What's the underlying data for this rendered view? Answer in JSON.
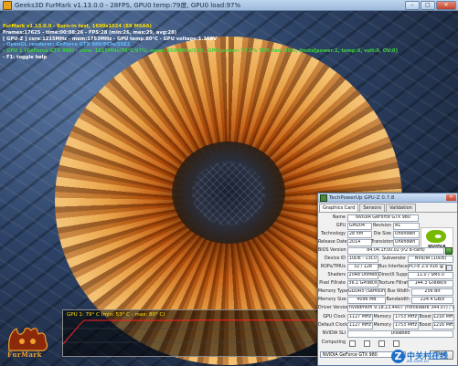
{
  "furmark": {
    "title": "Geeks3D FurMark v1.13.0.0 - 28FPS, GPU0 temp:79度, GPU0 load:97%",
    "controls": {
      "minimize": "–",
      "maximize": "□",
      "close": "✕"
    },
    "osd": [
      {
        "text": "FurMark v1.13.0.0 - Burn-in test, 1600x1024 (8X MSAA)",
        "color": "#ffe000"
      },
      {
        "text": "Frames:17625 - time:00:08:26 - FPS:28 (min:26, max:29, avg:28)",
        "color": "#ffffff"
      },
      {
        "text": "[ GPU-Z ] core:1215MHz - mem:1753MHz - GPU temp:80°C - GPU voltage:1.168V",
        "color": "#ffffff"
      },
      {
        "text": "- OpenGL renderer: GeForce GTX 980/PCIe/SSE2",
        "color": "#60c0ff"
      },
      {
        "text": "- GPU 1 (GeForce GTX 980) - core: 1215MHz/79°C/97%, mem: 3505MHz/13%, GPU power: 77.1% TDP, fan: 55%, limits[power:1, temp:0, volt:0, OV:0]",
        "color": "#40d040"
      },
      {
        "text": "- F1: toggle help",
        "color": "#ffffff"
      }
    ],
    "graph_label": "GPU 1: 79° C (min: 53° C - max: 80° C)",
    "gpu_temperature": {
      "current_c": 79,
      "min_c": 53,
      "max_c": 80
    },
    "logo_text": "FurMark"
  },
  "gpuz": {
    "title": "TechPowerUp GPU-Z 0.7.8",
    "close_glyph": "✕",
    "tabs": [
      "Graphics Card",
      "Sensors",
      "Validation"
    ],
    "vendor_logo": "NVIDIA",
    "fields": {
      "name_label": "Name",
      "name": "NVIDIA GeForce GTX 980",
      "gpu_label": "GPU",
      "gpu": "GM204",
      "revision_label": "Revision",
      "revision": "A1",
      "technology_label": "Technology",
      "technology": "28 nm",
      "die_size_label": "Die Size",
      "die_size": "Unknown",
      "release_date_label": "Release Date",
      "release_date": "2014",
      "transistors_label": "Transistors",
      "transistors": "Unknown",
      "bios_label": "BIOS Version",
      "bios": "84.04.1F.00.02 (P2 8-card)",
      "device_id_label": "Device ID",
      "device_id": "10DE - 13C0",
      "subvendor_label": "Subvendor",
      "subvendor": "NVIDIA (10DE)",
      "rops_label": "ROPs/TMUs",
      "rops": "32 / 128",
      "bus_label": "Bus Interface",
      "bus": "PCI-E 2.0 x16 @ x16 2.0",
      "shaders_label": "Shaders",
      "shaders": "2048 Unified",
      "directx_label": "DirectX Support",
      "directx": "11.0 / SM5.0",
      "pixel_label": "Pixel Fillrate",
      "pixel": "36.1 GPixel/s",
      "texture_label": "Texture Fillrate",
      "texture": "144.3 GTexel/s",
      "memtype_label": "Memory Type",
      "memtype": "GDDR5 (Samsung)",
      "buswidth_label": "Bus Width",
      "buswidth": "256 Bit",
      "memsize_label": "Memory Size",
      "memsize": "4096 MB",
      "bandwidth_label": "Bandwidth",
      "bandwidth": "224.4 GB/s",
      "driver_label": "Driver Version",
      "driver": "nvlddmkm 9.18.13.4407 (ForceWare 344.07) / Win7 64",
      "gpuclock_label": "GPU Clock",
      "gpuclock": "1127 MHz",
      "memory_label": "Memory",
      "memory": "1753 MHz",
      "boost_label": "Boost",
      "boost": "1216 MHz",
      "defclock_label": "Default Clock",
      "defclock": "1127 MHz",
      "defmemory_label": "Memory",
      "defmemory": "1753 MHz",
      "defboost_label": "Boost",
      "defboost": "1216 MHz",
      "sli_label": "NVIDIA SLI",
      "sli": "Disabled",
      "computing_label": "Computing"
    },
    "selected_card": "NVIDIA GeForce GTX 980",
    "close_button": "Close"
  },
  "watermark": {
    "logo": "Z",
    "text": "中关村在线",
    "url": "zol.com.cn"
  },
  "colors": {
    "nvidia_green": "#76b900",
    "osd_yellow": "#ffe000",
    "zol_blue": "#1c6fc8"
  }
}
